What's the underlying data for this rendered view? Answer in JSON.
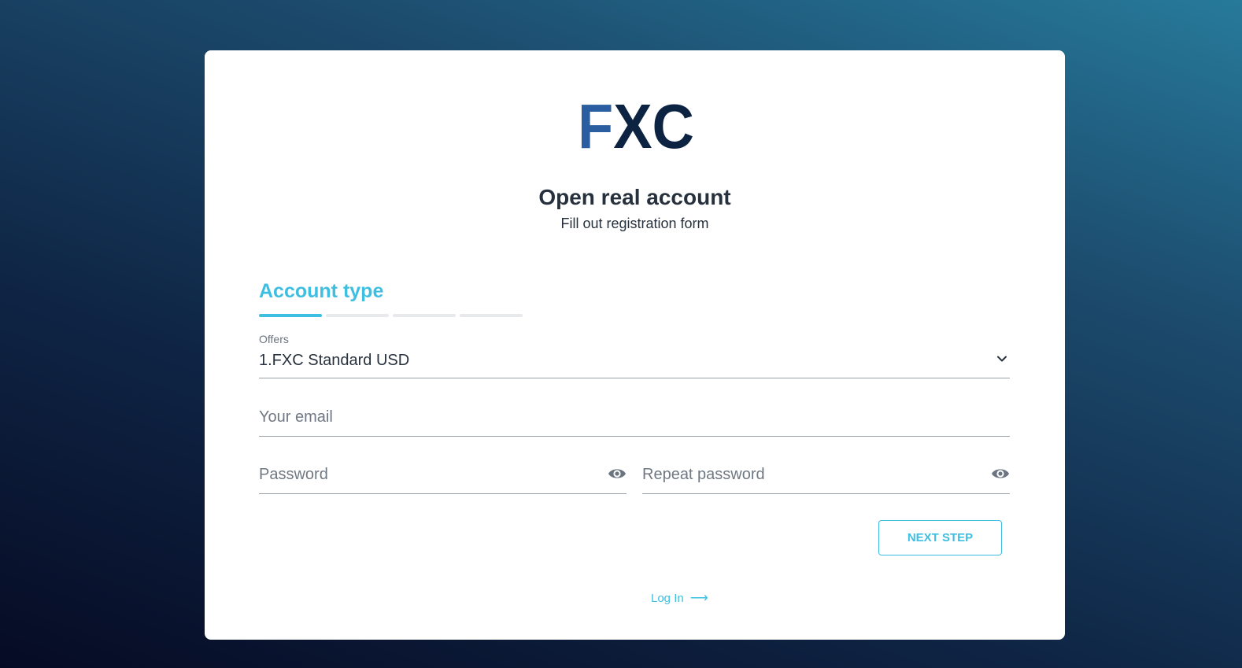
{
  "brand": {
    "logo_text": "FXC"
  },
  "header": {
    "title": "Open real account",
    "subtitle": "Fill out registration form"
  },
  "step": {
    "title": "Account type",
    "current": 1,
    "total": 4
  },
  "form": {
    "offers": {
      "label": "Offers",
      "value": "1.FXC Standard USD"
    },
    "email": {
      "placeholder": "Your email"
    },
    "password": {
      "placeholder": "Password"
    },
    "repeat_password": {
      "placeholder": "Repeat password"
    },
    "next_label": "NEXT STEP"
  },
  "footer": {
    "login_label": "Log In",
    "login_arrow": "⟶"
  },
  "colors": {
    "accent": "#3ebfe2",
    "logo_blue": "#2a5ea0",
    "logo_navy": "#0c2342",
    "text": "#27313d"
  }
}
